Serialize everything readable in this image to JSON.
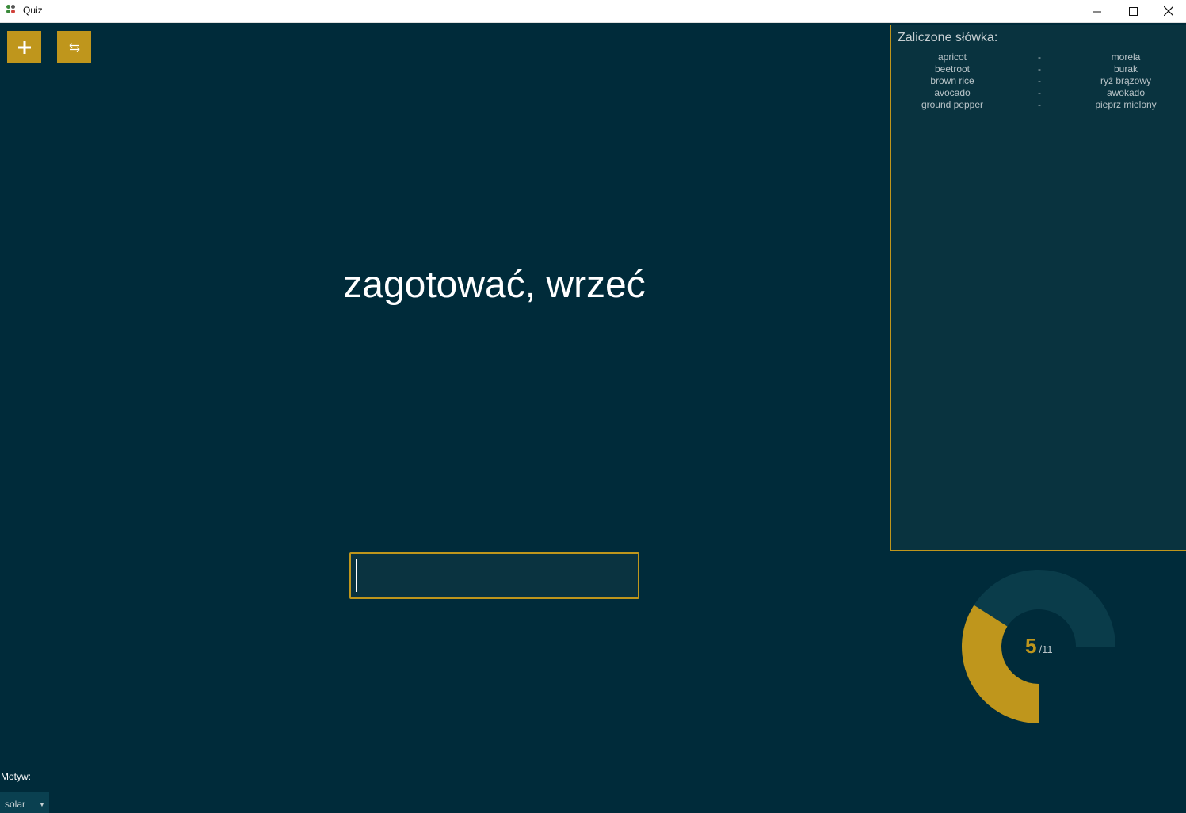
{
  "window": {
    "title": "Quiz"
  },
  "toolbar": {
    "add_icon": "plus-icon",
    "swap_icon": "swap-arrows-icon"
  },
  "quiz": {
    "current_word": "zagotować, wrzeć",
    "answer_value": ""
  },
  "passed": {
    "title": "Zaliczone słówka:",
    "separator": "-",
    "items": [
      {
        "en": "apricot",
        "pl": "morela"
      },
      {
        "en": "beetroot",
        "pl": "burak"
      },
      {
        "en": "brown rice",
        "pl": "ryż brązowy"
      },
      {
        "en": "avocado",
        "pl": "awokado"
      },
      {
        "en": "ground pepper",
        "pl": "pieprz mielony"
      }
    ]
  },
  "progress": {
    "done": "5",
    "total": "/11",
    "fraction": 0.4545
  },
  "theme": {
    "label": "Motyw:",
    "value": "solar"
  },
  "colors": {
    "background": "#002b3a",
    "accent": "#bf961c",
    "panel": "#09333f",
    "track": "#0a3c4a"
  }
}
